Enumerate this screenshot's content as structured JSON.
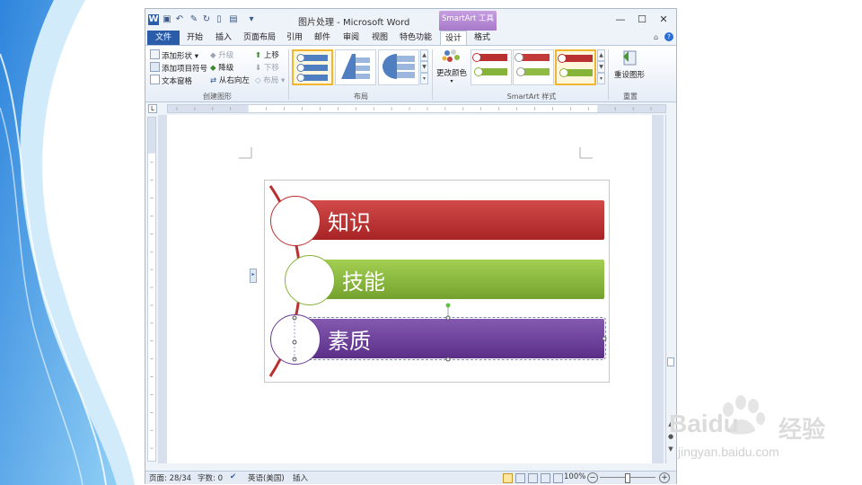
{
  "window": {
    "title": "图片处理 - Microsoft Word",
    "context_tab": "SmartArt 工具",
    "min_symbol": "—",
    "max_symbol": "☐",
    "close_symbol": "✕"
  },
  "tabs": [
    {
      "label": "文件"
    },
    {
      "label": "开始"
    },
    {
      "label": "插入"
    },
    {
      "label": "页面布局"
    },
    {
      "label": "引用"
    },
    {
      "label": "邮件"
    },
    {
      "label": "审阅"
    },
    {
      "label": "视图"
    },
    {
      "label": "特色功能"
    },
    {
      "label": "设计"
    },
    {
      "label": "格式"
    }
  ],
  "ribbon": {
    "create_group": {
      "add_shape": "添加形状 ▾",
      "add_bullet": "添加项目符号",
      "text_pane": "文本窗格",
      "promote": "升级",
      "demote": "降级",
      "right_to_left": "从右向左",
      "move_up": "上移",
      "move_down": "下移",
      "layout": "布局 ▾",
      "label": "创建图形"
    },
    "layout_group": {
      "label": "布局"
    },
    "styles_group": {
      "change_colors": "更改颜色",
      "label": "SmartArt 样式"
    },
    "reset_group": {
      "reset_graphic": "重设图形",
      "label": "重置"
    }
  },
  "document": {
    "smartart_items": [
      {
        "text": "知识",
        "color": "#b93030"
      },
      {
        "text": "技能",
        "color": "#86b43a"
      },
      {
        "text": "素质",
        "color": "#6a3d96"
      }
    ]
  },
  "status": {
    "page": "页面: 28/34",
    "words": "字数: 0",
    "language": "英语(美国)",
    "insert_mode": "插入",
    "zoom": "100%",
    "zoom_out": "−",
    "zoom_in": "+"
  },
  "watermark": {
    "brand": "Baidu",
    "brand_cn": "经验",
    "url": "jingyan.baidu.com"
  },
  "colors": {
    "accent": "#2a5caa",
    "context_tab": "#b286d3",
    "swirl": "#1e8fe0"
  }
}
